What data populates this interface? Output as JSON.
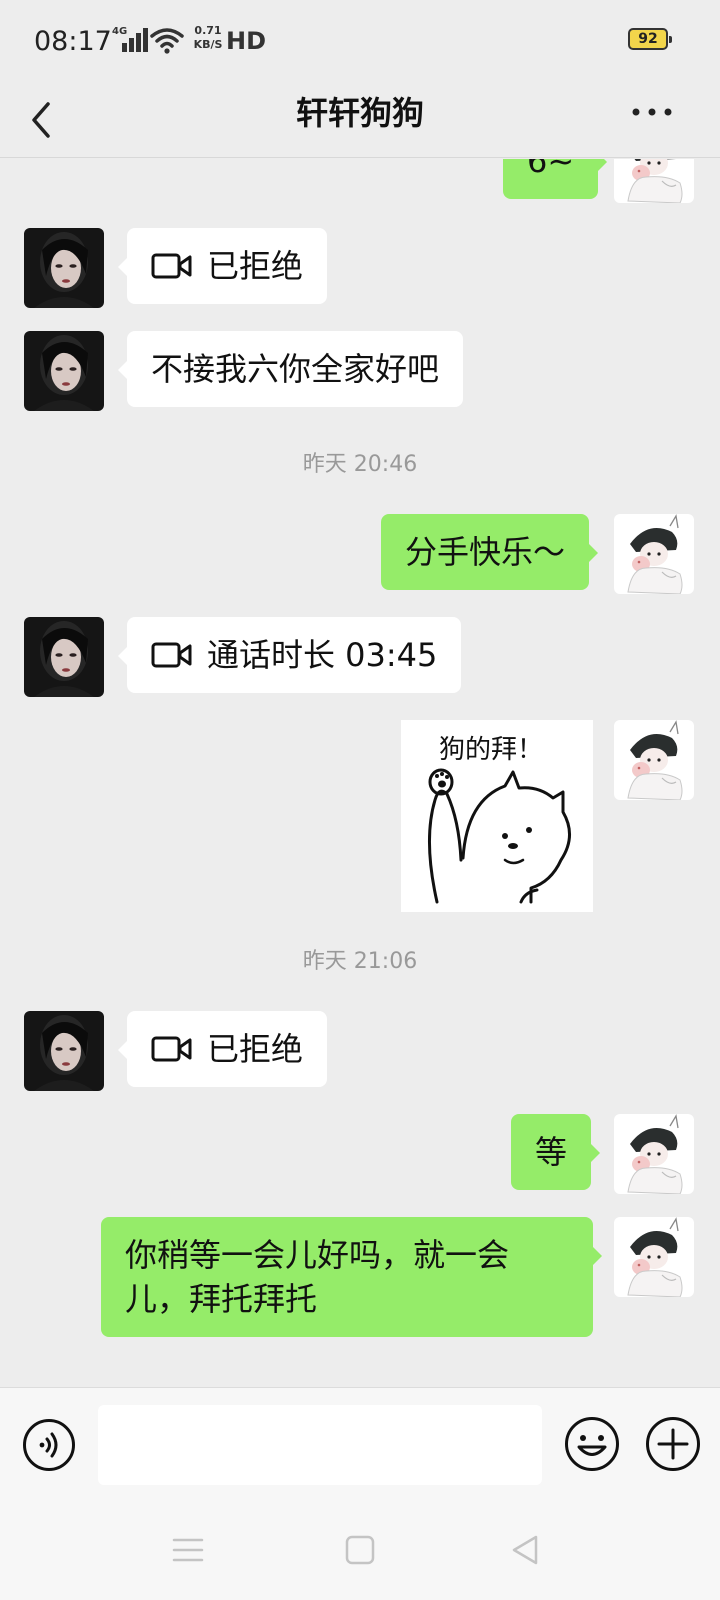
{
  "status_bar": {
    "time": "08:17",
    "network_type": "4G",
    "net_speed_value": "0.71",
    "net_speed_unit": "KB/S",
    "hd": "HD",
    "battery": "92"
  },
  "header": {
    "title": "轩轩狗狗",
    "back_icon": "chevron-left-icon",
    "more_icon": "more-dots-icon"
  },
  "messages": [
    {
      "type": "text",
      "side": "right",
      "text": "6~"
    },
    {
      "type": "call",
      "side": "left",
      "icon": "video-call-icon",
      "text": "已拒绝"
    },
    {
      "type": "text",
      "side": "left",
      "text": "不接我六你全家好吧"
    },
    {
      "type": "timestamp",
      "text": "昨天 20:46"
    },
    {
      "type": "text",
      "side": "right",
      "text": "分手快乐～"
    },
    {
      "type": "call",
      "side": "left",
      "icon": "video-call-icon",
      "text": "通话时长 03:45"
    },
    {
      "type": "sticker",
      "side": "right",
      "text": "狗的拜！"
    },
    {
      "type": "timestamp",
      "text": "昨天 21:06"
    },
    {
      "type": "call",
      "side": "left",
      "icon": "video-call-icon",
      "text": "已拒绝"
    },
    {
      "type": "text",
      "side": "right",
      "text": "等"
    },
    {
      "type": "text",
      "side": "right",
      "text": "你稍等一会儿好吗，就一会儿，拜托拜托"
    }
  ],
  "input_bar": {
    "voice_icon": "voice-icon",
    "emoji_icon": "emoji-icon",
    "plus_icon": "plus-icon"
  },
  "system_nav": {
    "icons": [
      "menu-icon",
      "home-icon",
      "back-triangle-icon"
    ]
  },
  "colors": {
    "background": "#ededed",
    "outgoing_bubble": "#95ec69",
    "incoming_bubble": "#ffffff",
    "timestamp_text": "#999999",
    "battery_fill": "#f2d54b"
  }
}
